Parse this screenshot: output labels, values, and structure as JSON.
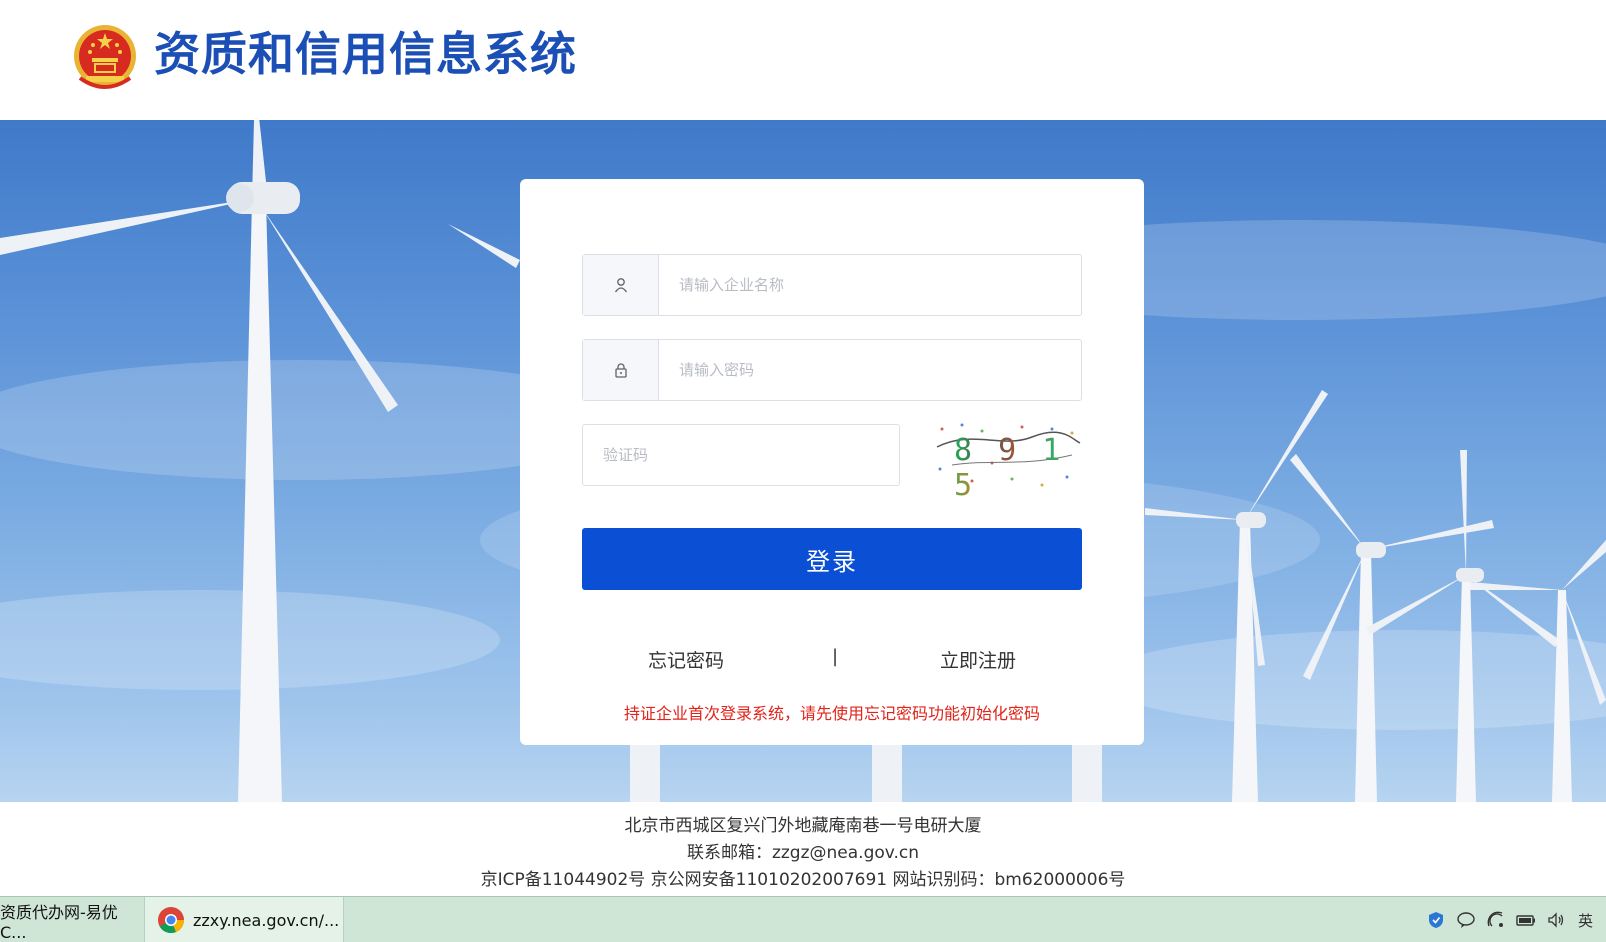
{
  "header": {
    "title": "资质和信用信息系统",
    "emblem_icon": "national-emblem-icon"
  },
  "login": {
    "username_placeholder": "请输入企业名称",
    "password_placeholder": "请输入密码",
    "captcha_placeholder": "验证码",
    "captcha_text": "8 9 1 5",
    "login_label": "登录",
    "forgot_label": "忘记密码",
    "separator": "|",
    "register_label": "立即注册",
    "notice": "持证企业首次登录系统，请先使用忘记密码功能初始化密码"
  },
  "footer": {
    "address": "北京市西城区复兴门外地藏庵南巷一号电研大厦",
    "email": "联系邮箱：zzgz@nea.gov.cn",
    "icp": "京ICP备11044902号 京公网安备11010202007691 网站识别码：bm62000006号"
  },
  "taskbar": {
    "task1": "资质代办网-易优C...",
    "task2": "zzxy.nea.gov.cn/...",
    "tray_icons": [
      "shield-icon",
      "chat-icon",
      "wifi-icon",
      "battery-icon",
      "volume-icon",
      "ime-icon"
    ]
  },
  "colors": {
    "title": "#1c4fb6",
    "login_button": "#0b4fd5",
    "notice": "#e2231a",
    "taskbar": "#cfe6d7"
  }
}
